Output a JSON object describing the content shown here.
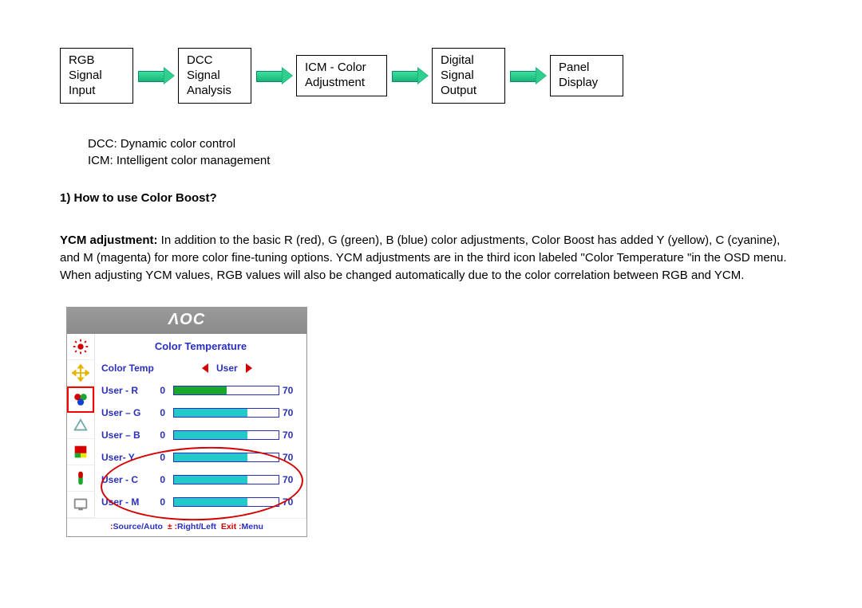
{
  "flow": {
    "boxes": [
      "RGB\nSignal\nInput",
      "DCC\nSignal\nAnalysis",
      "ICM - Color\nAdjustment",
      "Digital\nSignal\nOutput",
      "Panel\nDisplay"
    ]
  },
  "notes": {
    "dcc": "DCC: Dynamic color control",
    "icm": "ICM: Intelligent color management"
  },
  "heading": "1) How to use Color Boost?",
  "paragraph_lead": "YCM adjustment:",
  "paragraph_body": " In addition to the basic R (red), G (green), B (blue) color adjustments, Color Boost has added Y (yellow), C (cyanine), and M (magenta) for more color fine-tuning options. YCM adjustments are in the third icon labeled \"Color Temperature \"in the OSD menu. When adjusting YCM values, RGB values will also be changed automatically due to the color correlation between RGB and YCM.",
  "osd": {
    "brand": "ΛOC",
    "subtitle": "Color Temperature",
    "mode_label": "Color Temp",
    "mode_value": "User",
    "sliders": [
      {
        "label": "User - R",
        "min": "0",
        "max": "70",
        "pct": 50,
        "style": "green"
      },
      {
        "label": "User – G",
        "min": "0",
        "max": "70",
        "pct": 70,
        "style": "cyan"
      },
      {
        "label": "User – B",
        "min": "0",
        "max": "70",
        "pct": 70,
        "style": "cyan"
      },
      {
        "label": "User- Y",
        "min": "0",
        "max": "70",
        "pct": 70,
        "style": "cyan"
      },
      {
        "label": "User - C",
        "min": "0",
        "max": "70",
        "pct": 70,
        "style": "cyan"
      },
      {
        "label": "User - M",
        "min": "0",
        "max": "70",
        "pct": 70,
        "style": "cyan"
      }
    ],
    "footer": {
      "l1": ":",
      "t1": "Source/Auto",
      "l2": "± :",
      "t2": "Right/Left",
      "l3": "Exit :",
      "t3": "Menu"
    }
  }
}
